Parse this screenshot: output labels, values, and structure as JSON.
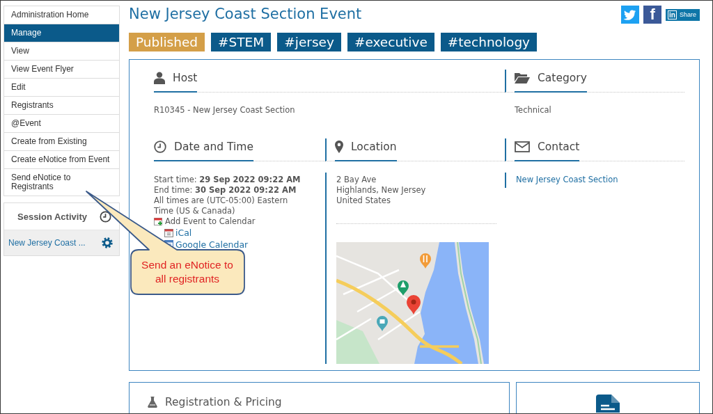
{
  "sidebar": {
    "menu": [
      {
        "label": "Administration Home",
        "selected": false
      },
      {
        "label": "Manage",
        "selected": true
      },
      {
        "label": "View",
        "selected": false
      },
      {
        "label": "View Event Flyer",
        "selected": false
      },
      {
        "label": "Edit",
        "selected": false
      },
      {
        "label": "Registrants",
        "selected": false
      },
      {
        "label": "@Event",
        "selected": false
      },
      {
        "label": "Create from Existing",
        "selected": false
      },
      {
        "label": "Create eNotice from Event",
        "selected": false
      },
      {
        "label": "Send eNotice to Registrants",
        "selected": false
      }
    ],
    "session": {
      "title": "Session Activity",
      "item": "New Jersey Coast ..."
    }
  },
  "header": {
    "title": "New Jersey Coast Section Event",
    "share": [
      {
        "kind": "bird"
      },
      {
        "kind": "letter",
        "text": "f"
      },
      {
        "kind": "labeled",
        "logo": "in",
        "label": "Share"
      }
    ]
  },
  "tags": [
    {
      "label": "Published",
      "color": "#d49f48"
    },
    {
      "label": "#STEM",
      "color": "#0b5a8a"
    },
    {
      "label": "#jersey",
      "color": "#0b5a8a"
    },
    {
      "label": "#executive",
      "color": "#0b5a8a"
    },
    {
      "label": "#technology",
      "color": "#0b5a8a"
    }
  ],
  "details": {
    "host": {
      "title": "Host",
      "value": "R10345 - New Jersey Coast Section"
    },
    "category": {
      "title": "Category",
      "value": "Technical"
    },
    "date_time": {
      "title": "Date and Time",
      "lines": [
        "Start time: **29 Sep 2022 09:22 AM**",
        "End time: **30 Sep 2022 09:22 AM**",
        "All times are (UTC-05:00) Eastern Time (US & Canada)"
      ],
      "calendar": {
        "label": "Add Event to Calendar",
        "links": [
          {
            "label": "iCal",
            "kind": "ical"
          },
          {
            "label": "Google Calendar",
            "kind": "google"
          }
        ]
      }
    },
    "location": {
      "title": "Location",
      "lines": [
        "2 Bay Ave",
        "Highlands, New Jersey",
        "United States"
      ]
    },
    "contact": {
      "title": "Contact",
      "link": "New Jersey Coast Section"
    }
  },
  "registration": {
    "title": "Registration & Pricing"
  },
  "callout": {
    "text": "Send an eNotice to all registrants"
  }
}
